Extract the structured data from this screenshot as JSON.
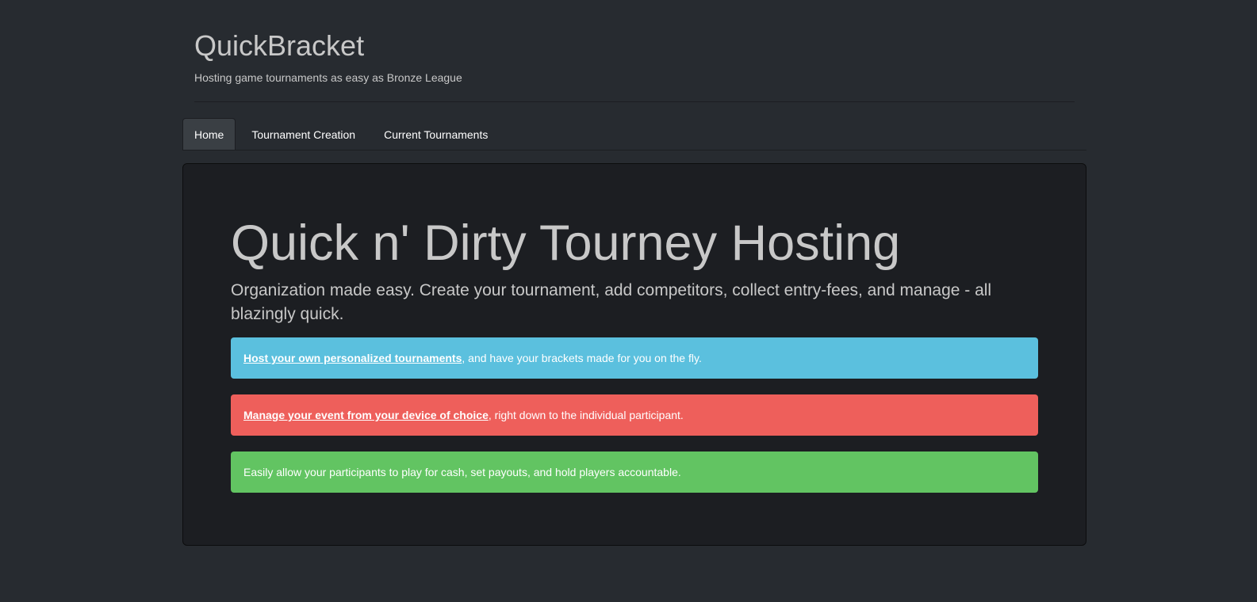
{
  "header": {
    "title": "QuickBracket",
    "tagline": "Hosting game tournaments as easy as Bronze League"
  },
  "nav": {
    "tabs": [
      {
        "label": "Home",
        "active": true
      },
      {
        "label": "Tournament Creation",
        "active": false
      },
      {
        "label": "Current Tournaments",
        "active": false
      }
    ]
  },
  "hero": {
    "title": "Quick n' Dirty Tourney Hosting",
    "lead": "Organization made easy. Create your tournament, add competitors, collect entry-fees, and manage - all blazingly quick."
  },
  "features": {
    "host": {
      "link": "Host your own personalized tournaments",
      "text": ", and have your brackets made for you on the fly.",
      "color": "#5bc0de"
    },
    "manage": {
      "link": "Manage your event from your device of choice",
      "text": ", right down to the individual participant.",
      "color": "#ee5f5b"
    },
    "cash": {
      "text": "Easily allow your participants to play for cash, set payouts, and hold players accountable.",
      "color": "#62c462"
    }
  },
  "colors": {
    "background": "#272b30",
    "panel": "#1c1e22",
    "active_tab": "#3a3f44",
    "text": "#c8c8c8"
  }
}
